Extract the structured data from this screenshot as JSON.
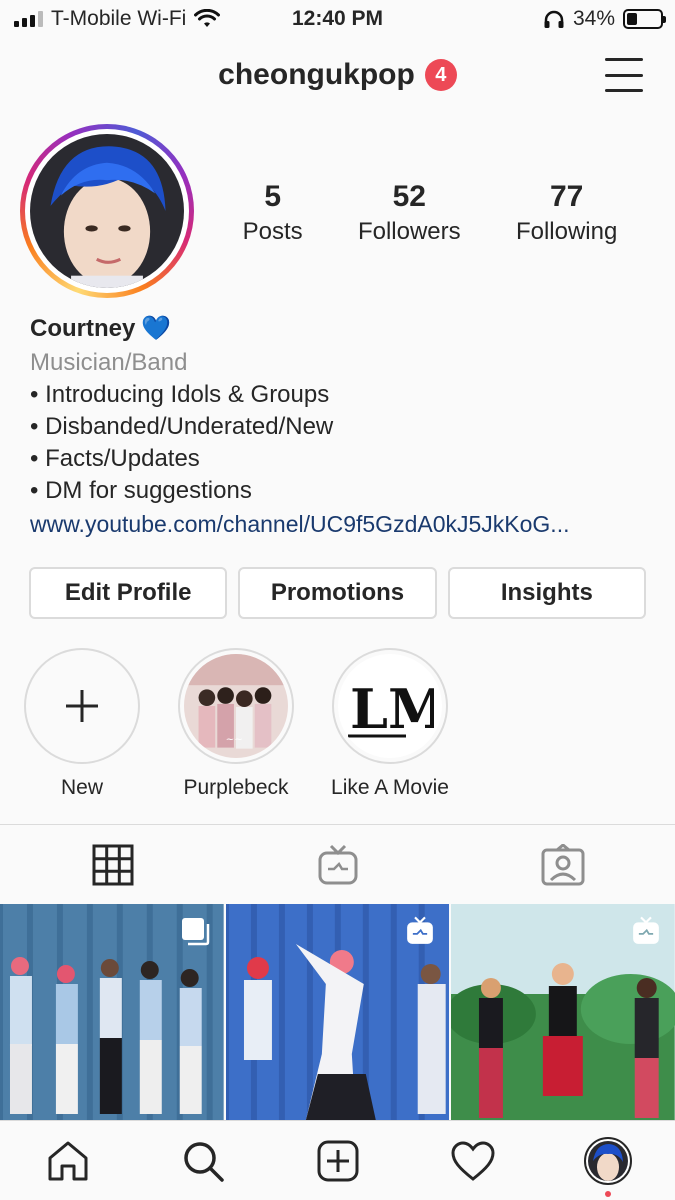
{
  "status_bar": {
    "carrier": "T-Mobile Wi-Fi",
    "time": "12:40 PM",
    "battery": "34%",
    "battery_level": 0.34
  },
  "header": {
    "username": "cheongukpop",
    "notification_count": "4",
    "menu_icon": "hamburger-menu-icon"
  },
  "stats": {
    "posts_count": "5",
    "posts_label": "Posts",
    "followers_count": "52",
    "followers_label": "Followers",
    "following_count": "77",
    "following_label": "Following"
  },
  "bio": {
    "name": "Courtney",
    "name_emoji": "💙",
    "category": "Musician/Band",
    "lines": [
      "• Introducing Idols & Groups",
      "• Disbanded/Underated/New",
      "• Facts/Updates",
      "• DM for suggestions"
    ],
    "link": "www.youtube.com/channel/UC9f5GzdA0kJ5JkKoG..."
  },
  "buttons": {
    "edit_profile": "Edit Profile",
    "promotions": "Promotions",
    "insights": "Insights"
  },
  "highlights": [
    {
      "label": "New",
      "icon": "plus-icon"
    },
    {
      "label": "Purplebeck"
    },
    {
      "label": "Like A Movie",
      "logo_text": "LM"
    }
  ],
  "tabs": [
    {
      "name": "grid",
      "icon": "grid-icon",
      "active": true
    },
    {
      "name": "igtv",
      "icon": "igtv-icon"
    },
    {
      "name": "tagged",
      "icon": "tagged-icon"
    }
  ],
  "bottom_nav": [
    {
      "icon": "home-icon"
    },
    {
      "icon": "search-icon"
    },
    {
      "icon": "add-post-icon"
    },
    {
      "icon": "heart-icon"
    },
    {
      "icon": "profile-avatar"
    }
  ]
}
